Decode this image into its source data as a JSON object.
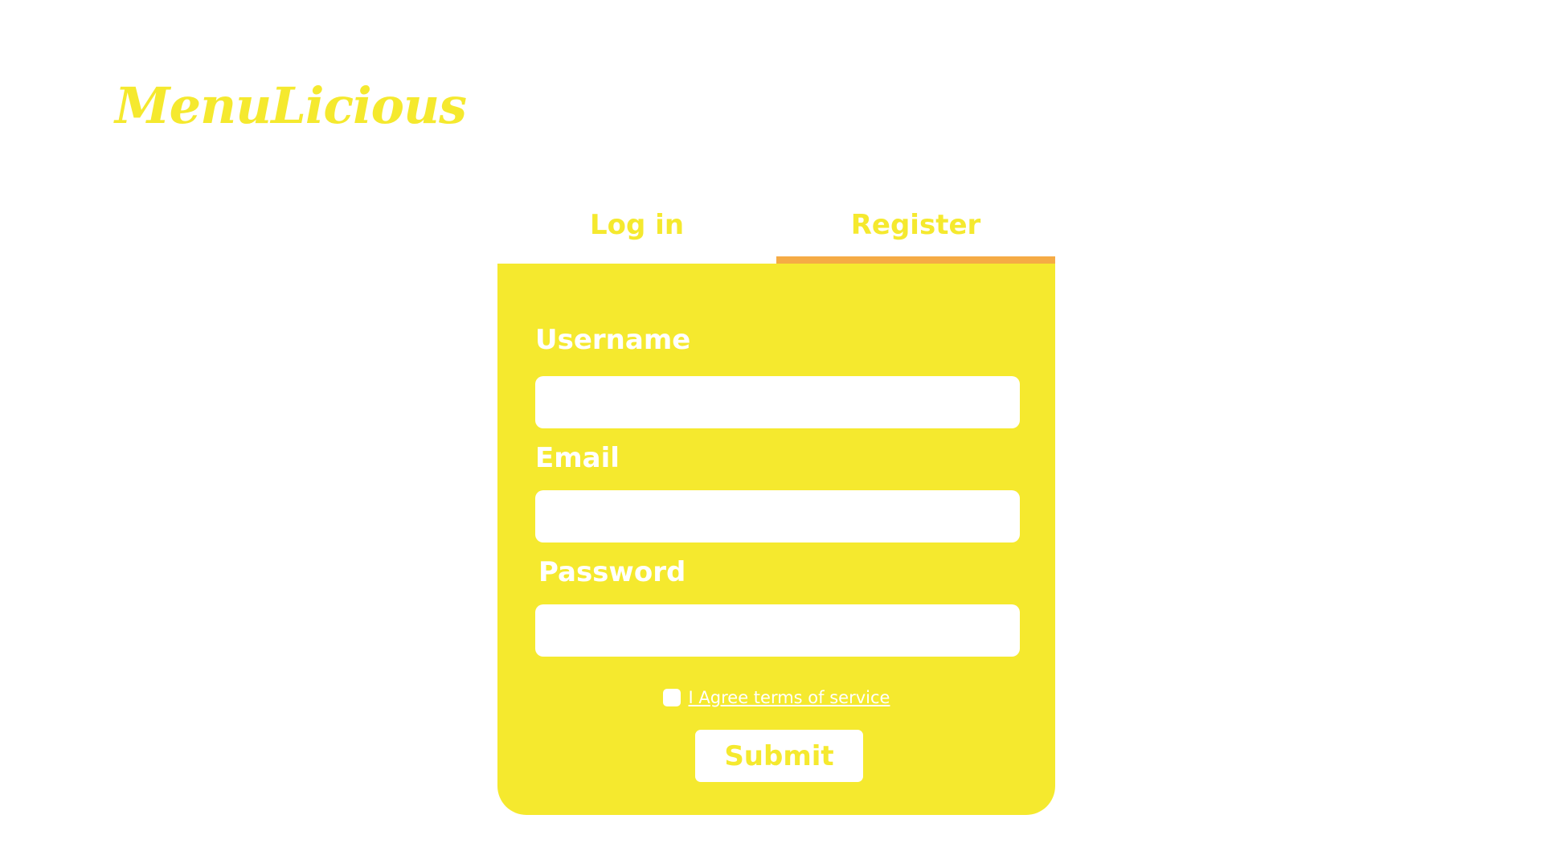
{
  "brand": {
    "logo_text": "MenuLicious"
  },
  "tabs": [
    {
      "label": "Log in",
      "active": false
    },
    {
      "label": "Register",
      "active": true
    }
  ],
  "form": {
    "username": {
      "label": "Username",
      "value": "",
      "placeholder": ""
    },
    "email": {
      "label": "Email",
      "value": "",
      "placeholder": ""
    },
    "password": {
      "label": "Password",
      "value": "",
      "placeholder": ""
    },
    "terms_label": "I Agree terms of service",
    "terms_checked": false,
    "submit_label": "Submit"
  },
  "colors": {
    "accent_yellow": "#f5e92e",
    "tab_underline": "#f5ab45",
    "background": "#ffffff"
  }
}
